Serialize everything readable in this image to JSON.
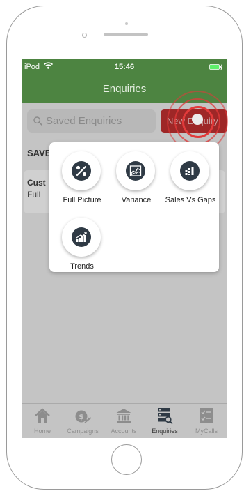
{
  "status_bar": {
    "carrier": "iPod",
    "time": "15:46"
  },
  "header": {
    "title": "Enquiries"
  },
  "search": {
    "placeholder": "Saved Enquiries"
  },
  "actions": {
    "new_enquiry_label": "New Enquiry"
  },
  "saved_section": {
    "label": "SAVE"
  },
  "saved_card": {
    "title": "Cust",
    "subtitle": "Full"
  },
  "popup_menu": {
    "options": [
      {
        "label": "Full Picture",
        "icon": "percent-icon"
      },
      {
        "label": "Variance",
        "icon": "area-chart-icon"
      },
      {
        "label": "Sales Vs Gaps",
        "icon": "bar-grid-icon"
      },
      {
        "label": "Trends",
        "icon": "trend-chart-icon"
      }
    ]
  },
  "tab_bar": {
    "tabs": [
      {
        "label": "Home",
        "icon": "home-icon"
      },
      {
        "label": "Campaigns",
        "icon": "money-bag-icon"
      },
      {
        "label": "Accounts",
        "icon": "bank-icon"
      },
      {
        "label": "Enquiries",
        "icon": "enquiries-icon",
        "active": true
      },
      {
        "label": "MyCalls",
        "icon": "checklist-icon"
      }
    ]
  },
  "colors": {
    "header_green": "#4d8441",
    "new_enquiry_red": "#9e2727",
    "tap_indicator": "#e23a3a",
    "icon_dark": "#2f3a45",
    "overlay_gray": "#c4c4c4"
  }
}
